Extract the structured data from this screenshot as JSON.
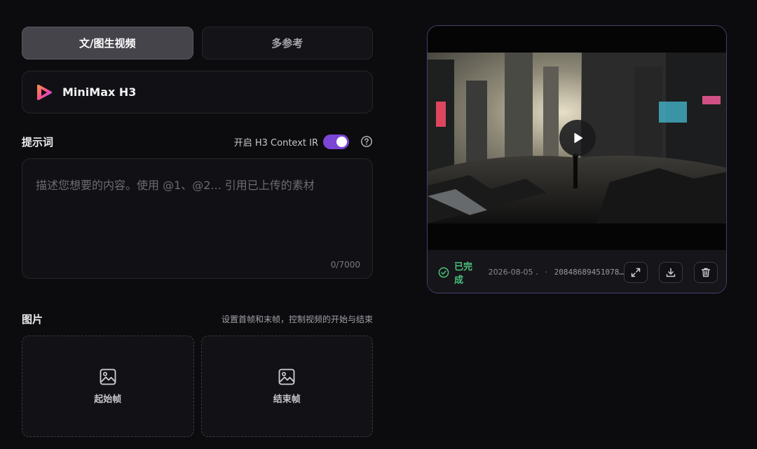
{
  "mode_tabs": [
    {
      "label": "文/图生视频",
      "active": true
    },
    {
      "label": "多参考",
      "active": false
    }
  ],
  "model": {
    "name": "MiniMax H3",
    "icon": "play-logo-icon"
  },
  "prompt": {
    "title": "提示词",
    "context_label": "开启 H3 Context IR",
    "context_enabled": true,
    "placeholder": "描述您想要的内容。使用 @1、@2... 引用已上传的素材",
    "char_count": "0/7000"
  },
  "images": {
    "title": "图片",
    "hint": "设置首帧和末帧，控制视频的开始与结束",
    "start_frame_label": "起始帧",
    "end_frame_label": "结束帧"
  },
  "video": {
    "status": "已完成",
    "date": "2026-08-05 …",
    "separator": "·",
    "task_id": "20848689451078…",
    "accent": "#7b45d6",
    "status_color": "#4ac27b"
  }
}
